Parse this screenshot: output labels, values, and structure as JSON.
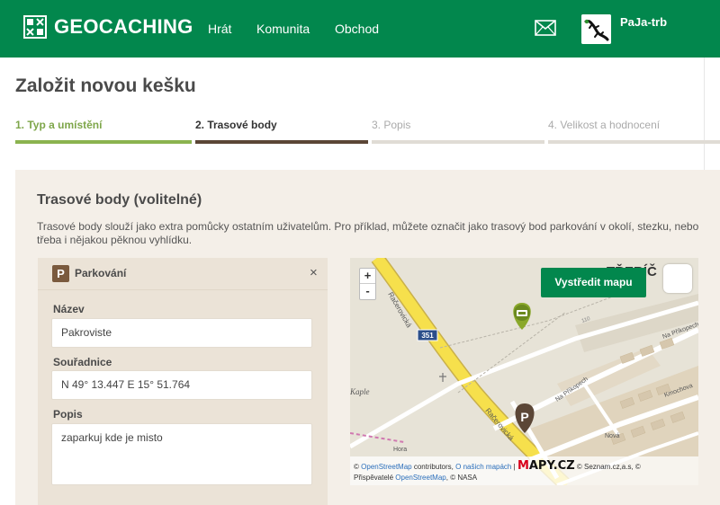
{
  "header": {
    "logo_text": "GEOCACHING",
    "nav": [
      "Hrát",
      "Komunita",
      "Obchod"
    ],
    "username": "PaJa-trb"
  },
  "page": {
    "title": "Založit novou kešku"
  },
  "steps": [
    {
      "label": "1. Typ a umístění",
      "state": "done"
    },
    {
      "label": "2. Trasové body",
      "state": "active"
    },
    {
      "label": "3. Popis",
      "state": "pending"
    },
    {
      "label": "4. Velikost a hodnocení",
      "state": "pending"
    }
  ],
  "waypoints": {
    "title": "Trasové body (volitelné)",
    "description": "Trasové body slouží jako extra pomůcky ostatním uživatelům. Pro příklad, můžete označit jako trasový bod parkování v okolí, stezku, nebo třeba i nějakou pěknou vyhlídku.",
    "card": {
      "type_label": "Parkování",
      "type_icon": "P",
      "close": "×",
      "name_label": "Název",
      "name_value": "Pakroviste",
      "coords_label": "Souřadnice",
      "coords_value": "N 49° 13.447 E 15° 51.764",
      "note_label": "Popis",
      "note_value": "zaparkuj kde je misto"
    }
  },
  "map": {
    "zoom_in": "+",
    "zoom_out": "-",
    "center_button": "Vystředit mapu",
    "labels": {
      "city": "TŘEBÍČ",
      "street1": "Račerovická",
      "street2": "Račerovická",
      "road_number": "351",
      "kaple": "Kaple",
      "street_prikopech1": "Na Příkopech",
      "street_prikopech2": "Na Příkopech",
      "street_kmochova": "Kmochova",
      "street_nova": "Nová",
      "street_hora": "Hora",
      "height": "110"
    },
    "attribution": {
      "copy1": "©",
      "osm": "OpenStreetMap",
      "contributors": "contributors,",
      "about": "O našich mapách",
      "sep": "|",
      "seznam": "© Seznam.cz,a.s, ©",
      "prispevatele": "Přispěvatelé",
      "osm2": "OpenStreetMap",
      "nasa": ", © NASA",
      "brand_red": "M",
      "brand_rest": "APY.CZ"
    }
  },
  "colors": {
    "brand_green": "#02874d",
    "step_done": "#8bb34f",
    "step_active": "#5b4636",
    "step_pending": "#e0dcd5",
    "parking_brown": "#7a5a3e"
  }
}
